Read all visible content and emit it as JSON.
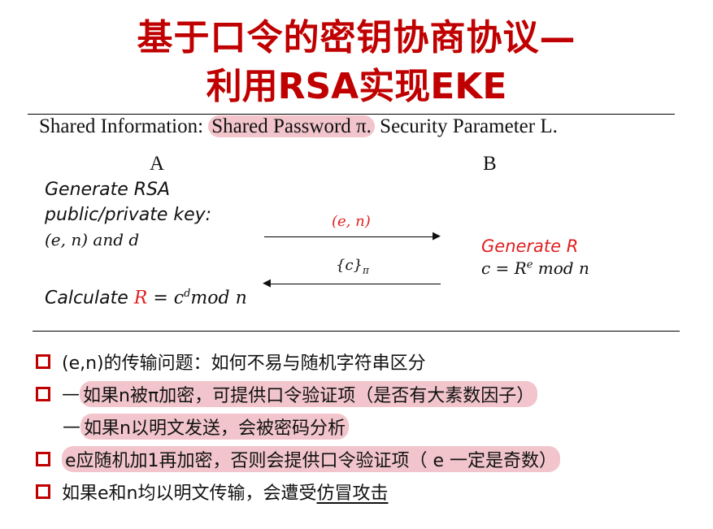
{
  "title": {
    "line1": "基于口令的密钥协商协议—",
    "line2": "利用RSA实现EKE"
  },
  "shared": {
    "label": "Shared Information: ",
    "password": "Shared Password π.",
    "param": " Security Parameter L."
  },
  "parties": {
    "a": "A",
    "b": "B"
  },
  "left": {
    "gen_line1": "Generate RSA",
    "gen_line2": "public/private key:",
    "gen_line3": "(e, n) and d",
    "calc_label": "Calculate ",
    "calc_R": "R",
    "calc_rest": " = c",
    "calc_sup": "d",
    "calc_tail": "mod n"
  },
  "arrows": {
    "to_b": "(e, n)",
    "to_a": "{c}",
    "to_a_sub": "π"
  },
  "right": {
    "gen": "Generate R",
    "c_eq": "c = R",
    "c_sup": "e",
    "c_tail": " mod n"
  },
  "bullets": [
    {
      "text": "(e,n)的传输问题：如何不易与随机字符串区分"
    },
    {
      "prefix": "—",
      "text": "如果n被π加密，可提供口令验证项（是否有大素数因子）"
    },
    {
      "prefix": "—",
      "text": "如果n以明文发送，会被密码分析"
    },
    {
      "text": "e应随机加1再加密，否则会提供口令验证项（ e 一定是奇数）"
    },
    {
      "pre": "如果e和n均以明文传输，会遭受",
      "under": "仿冒攻击"
    }
  ],
  "colors": {
    "title": "#c00000",
    "accent": "#e02020",
    "highlight": "#e696a0"
  }
}
